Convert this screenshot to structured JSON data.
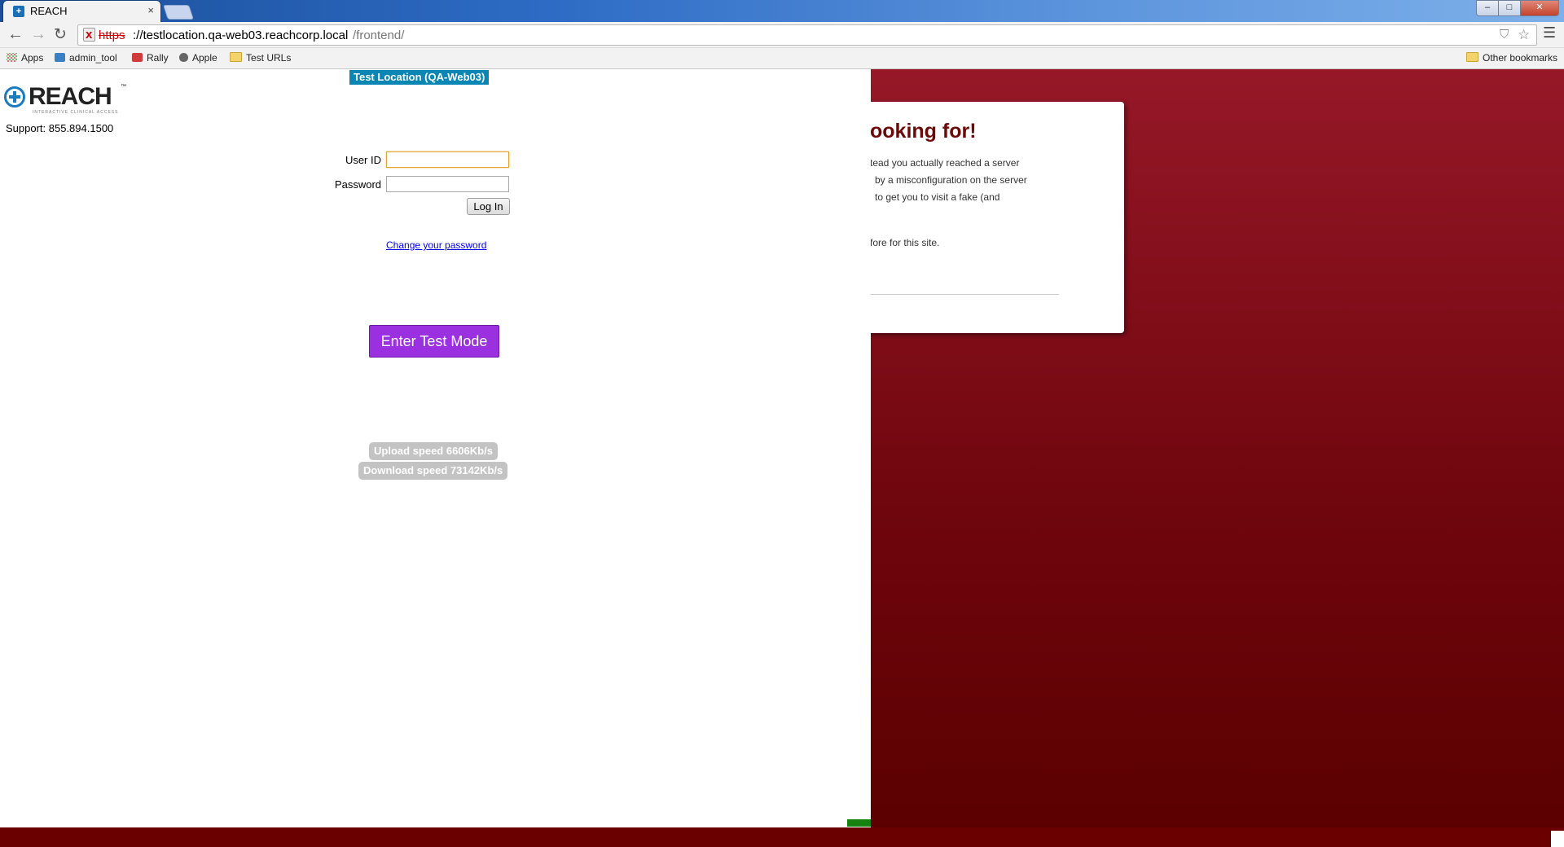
{
  "browser": {
    "tab_title": "REACH",
    "tab_close": "×",
    "favicon_glyph": "+",
    "url_scheme": "https",
    "url_host": "://testlocation.qa-web03.reachcorp.local",
    "url_path": "/frontend/",
    "security_state": "x",
    "window_controls": {
      "minimize": "–",
      "maximize": "□",
      "close": "✕"
    },
    "bookmarks": [
      {
        "label": "Apps",
        "icon": "apps-icon"
      },
      {
        "label": "admin_tool",
        "icon": "admin-tool-icon"
      },
      {
        "label": "Rally",
        "icon": "rally-icon"
      },
      {
        "label": "Apple",
        "icon": "apple-icon"
      },
      {
        "label": "Test URLs",
        "icon": "folder-icon"
      }
    ],
    "other_bookmarks": "Other bookmarks"
  },
  "error_page": {
    "heading": "ooking for!",
    "lines": [
      "tead you actually reached a server",
      "by a misconfiguration on the server",
      "to get you to visit a fake (and",
      "fore for this site."
    ],
    "colors": {
      "background_top": "#961828",
      "background_bottom": "#5a0000",
      "heading": "#6c0a0a"
    }
  },
  "login_page": {
    "env_badge": "Test Location (QA-Web03)",
    "logo": {
      "word": "REACH",
      "tm": "™",
      "tagline": "INTERACTIVE CLINICAL ACCESS"
    },
    "support": "Support: 855.894.1500",
    "userid_label": "User ID",
    "userid_value": "",
    "password_label": "Password",
    "password_value": "",
    "login_button": "Log In",
    "change_password_link": "Change your password",
    "test_mode_button": "Enter Test Mode",
    "upload_speed": "Upload speed 6606Kb/s",
    "download_speed": "Download speed 73142Kb/s",
    "colors": {
      "env_badge": "#0a86b5",
      "test_mode": "#9b30e0",
      "speed_pill": "#c3c3c3"
    }
  }
}
